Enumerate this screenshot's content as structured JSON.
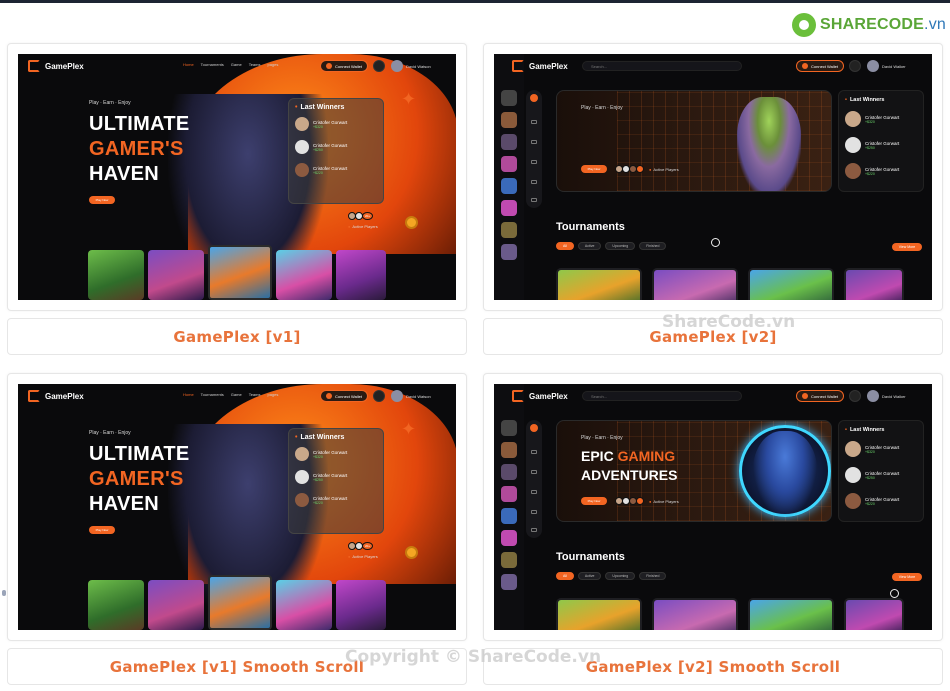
{
  "brand": {
    "name_bold": "SHARECODE",
    "name_suffix": ".vn"
  },
  "watermarks": {
    "center": "ShareCode.vn",
    "bottom": "Copyright © ShareCode.vn"
  },
  "cards": [
    {
      "caption": "GamePlex [v1]"
    },
    {
      "caption": "GamePlex [v2]"
    },
    {
      "caption": "GamePlex [v1] Smooth Scroll"
    },
    {
      "caption": "GamePlex [v2] Smooth Scroll"
    }
  ],
  "v1": {
    "logo": "GamePlex",
    "nav": [
      "Home",
      "Tournaments",
      "Game",
      "Teams",
      "pages"
    ],
    "wallet": "Connect Wallet",
    "user": "David Watson",
    "tagline": "Play  ·  Earn  ·  Enjoy",
    "title": [
      "ULTIMATE",
      "GAMER'S",
      "HAVEN"
    ],
    "cta": "Play Now",
    "winners_title": "Last Winners",
    "winners": [
      {
        "name": "Cristofer Gorwart",
        "prize": "+$320"
      },
      {
        "name": "Cristofer Gorwart",
        "prize": "+$250"
      },
      {
        "name": "Cristofer Gorwart",
        "prize": "+$220"
      }
    ],
    "active_players": "Active Players",
    "active_count": "20+"
  },
  "v2": {
    "logo": "GamePlex",
    "search_placeholder": "Search...",
    "wallet": "Connect Wallet",
    "user": "David Walker",
    "tagline": "Play  ·  Earn  ·  Enjoy",
    "title_line1_white": "EPIC ",
    "title_line1_orange": "GAMING",
    "title_line2": "ADVENTURES",
    "cta": "Play Now",
    "active_players": "Active Players",
    "winners_title": "Last Winners",
    "winners": [
      {
        "name": "Cristofer Gorwart",
        "prize": "+$320"
      },
      {
        "name": "Cristofer Gorwart",
        "prize": "+$250"
      },
      {
        "name": "Cristofer Gorwart",
        "prize": "+$220"
      }
    ],
    "tournaments_title": "Tournaments",
    "filters": [
      "All",
      "Active",
      "Upcoming",
      "Finished"
    ],
    "view_more": "View More"
  },
  "colors": {
    "accent": "#f26522",
    "caption": "#e8733b",
    "brand_green": "#5aa637"
  }
}
